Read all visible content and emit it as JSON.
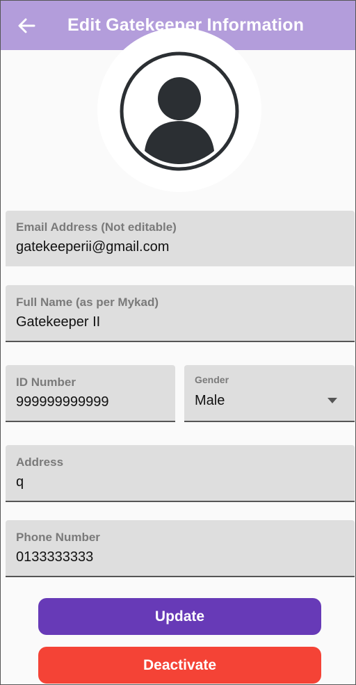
{
  "appbar": {
    "title": "Edit Gatekeeper Information",
    "back_icon": "arrow-left-icon"
  },
  "profile": {
    "avatar_icon": "account-circle-icon"
  },
  "form": {
    "email": {
      "label": "Email Address (Not editable)",
      "value": "gatekeeperii@gmail.com"
    },
    "full_name": {
      "label": "Full Name (as per Mykad)",
      "value": "Gatekeeper II"
    },
    "id_number": {
      "label": "ID Number",
      "value": "999999999999"
    },
    "gender": {
      "label": "Gender",
      "value": "Male",
      "icon": "dropdown-arrow-icon"
    },
    "address": {
      "label": "Address",
      "value": "q"
    },
    "phone": {
      "label": "Phone Number",
      "value": "0133333333"
    }
  },
  "actions": {
    "update_label": "Update",
    "deactivate_label": "Deactivate"
  },
  "colors": {
    "appbar": "#b39ddb",
    "update_button": "#673ab7",
    "deactivate_button": "#f44336",
    "field_fill": "#dedede"
  }
}
